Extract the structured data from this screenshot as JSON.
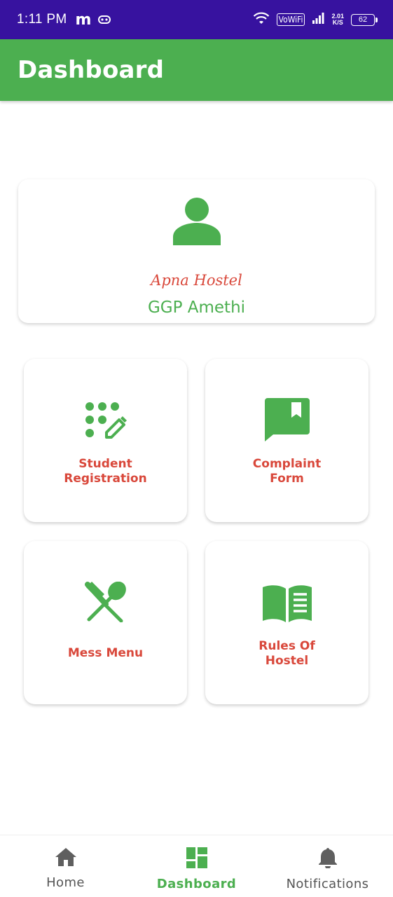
{
  "status_bar": {
    "time": "1:11 PM",
    "app_letter": "m",
    "vowifi": "VoWiFi",
    "speed_value": "2.01",
    "speed_unit": "K/S",
    "battery": "62"
  },
  "app_bar": {
    "title": "Dashboard"
  },
  "profile": {
    "avatar_icon": "person-icon",
    "brand": "Apna Hostel",
    "location": "GGP Amethi"
  },
  "tiles": [
    {
      "label": "Student\nRegistration",
      "icon": "dialpad-edit-icon"
    },
    {
      "label": "Complaint\nForm",
      "icon": "bookmark-chat-icon"
    },
    {
      "label": "Mess Menu",
      "icon": "restaurant-icon"
    },
    {
      "label": "Rules Of\nHostel",
      "icon": "menu-book-icon"
    }
  ],
  "bottom_nav": {
    "items": [
      {
        "label": "Home",
        "icon": "home-icon",
        "active": false
      },
      {
        "label": "Dashboard",
        "icon": "dashboard-icon",
        "active": true
      },
      {
        "label": "Notifications",
        "icon": "bell-icon",
        "active": false
      }
    ]
  },
  "colors": {
    "status_bar": "#37129f",
    "primary": "#4caf50",
    "accent_text": "#d9483b",
    "nav_inactive": "#555555"
  }
}
